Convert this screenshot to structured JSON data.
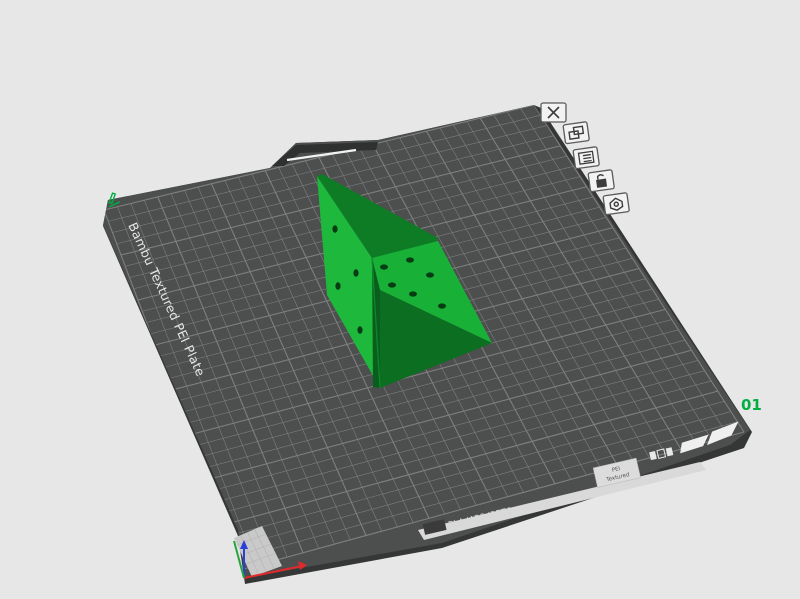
{
  "plate": {
    "name_text": "Bambu Textured PEI Plate",
    "number": "01",
    "materials_text": "PLA/ABS/PETG",
    "side_text_top": "PEI",
    "side_text_bottom": "Textured"
  },
  "plate_tools": [
    {
      "name": "remove-plate-button",
      "icon": "close-icon"
    },
    {
      "name": "arrange-button",
      "icon": "arrange-icon"
    },
    {
      "name": "plate-settings-button",
      "icon": "plate-settings-icon"
    },
    {
      "name": "lock-plate-button",
      "icon": "lock-icon"
    },
    {
      "name": "auto-orient-button",
      "icon": "orient-icon"
    }
  ],
  "colors": {
    "background": "#e6e7e6",
    "plate_surface": "#4d4e4e",
    "plate_grid": "#7e807f",
    "plate_rim": "#3a3b3b",
    "model_light": "#1eb83c",
    "model_mid": "#139a2e",
    "model_dark": "#0b6e21",
    "accent_green": "#00ae42",
    "axis_x": "#e0292b",
    "axis_y": "#27a53d",
    "axis_z": "#2b3ed6"
  }
}
